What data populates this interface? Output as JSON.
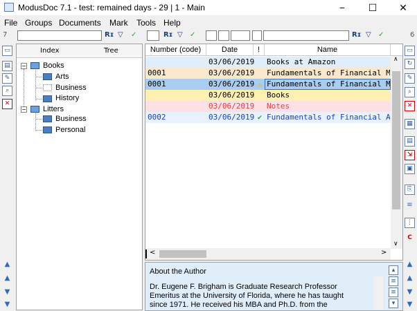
{
  "window": {
    "title": "ModusDoc 7.1 - test: remained days - 29 | 1 - Main",
    "minimize": "−",
    "maximize": "☐",
    "close": "✕"
  },
  "menu": [
    "File",
    "Groups",
    "Documents",
    "Mark",
    "Tools",
    "Help"
  ],
  "filterbar": {
    "left_num": "7",
    "right_num": "6",
    "tool_r": "Rɪ",
    "tool_filter": "▽",
    "tool_check": "✓"
  },
  "tree": {
    "tabs": [
      "Index",
      "Tree"
    ],
    "nodes": [
      {
        "label": "Books",
        "expander": "−"
      },
      {
        "label": "Arts"
      },
      {
        "label": "Business"
      },
      {
        "label": "History"
      },
      {
        "label": "Litters",
        "expander": "−"
      },
      {
        "label": "Business"
      },
      {
        "label": "Personal"
      }
    ]
  },
  "grid": {
    "columns": [
      "Number (code)",
      "Date",
      "!",
      "Name"
    ],
    "rows": [
      {
        "number": "",
        "date": "03/06/2019",
        "flag": "",
        "name": "Books at Amazon",
        "bg": "#e0eefa",
        "fg": "#000000"
      },
      {
        "number": "0001",
        "date": "03/06/2019",
        "flag": "",
        "name": "Fundamentals of Financial Management",
        "bg": "#fbe8cc",
        "fg": "#000000"
      },
      {
        "number": "0001",
        "date": "03/06/2019",
        "flag": "⚠",
        "name": "Fundamentals of Financial Management",
        "bg": "#a9cdee",
        "fg": "#000000"
      },
      {
        "number": "",
        "date": "03/06/2019",
        "flag": "",
        "name": "Books",
        "bg": "#fdf0b0",
        "fg": "#000000"
      },
      {
        "number": "",
        "date": "03/06/2019",
        "flag": "",
        "name": "Notes",
        "bg": "#fde0e6",
        "fg": "#e04040"
      },
      {
        "number": "0002",
        "date": "03/06/2019",
        "flag": "✔",
        "name": "Fundamentals of Financial Accounting",
        "bg": "#e8f2fc",
        "fg": "#1a3fb8"
      }
    ]
  },
  "preview": {
    "heading": "About the Author",
    "lines": [
      "Dr. Eugene F. Brigham is Graduate Research Professor",
      "Emeritus at the University of Florida, where he has taught",
      "since 1971. He received his MBA and Ph.D. from the"
    ]
  },
  "colors": {
    "warning": "#e8b400",
    "ok": "#3aa83a"
  }
}
